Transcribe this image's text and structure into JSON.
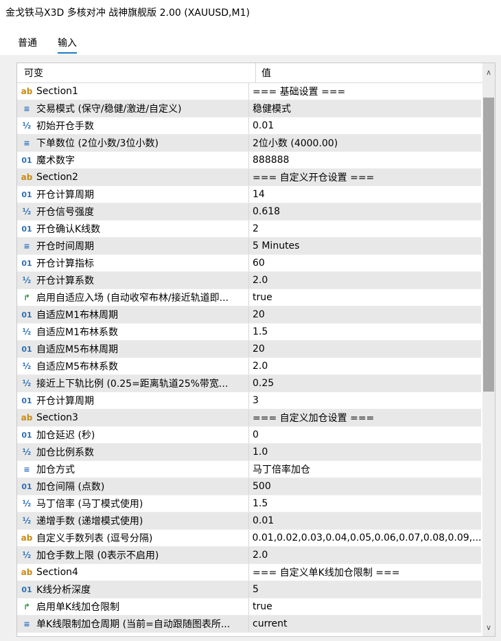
{
  "window": {
    "title": "金戈铁马X3D 多核对冲 战神旗舰版 2.00 (XAUUSD,M1)"
  },
  "tabs": [
    {
      "label": "普通",
      "active": false
    },
    {
      "label": "输入",
      "active": true
    }
  ],
  "grid": {
    "columns": [
      "可变",
      "值"
    ],
    "rows": [
      {
        "icon": "ab",
        "name": "Section1",
        "value": "=== 基础设置 ==="
      },
      {
        "icon": "enum",
        "name": "交易模式 (保守/稳健/激进/自定义)",
        "value": "稳健模式"
      },
      {
        "icon": "half",
        "name": "初始开仓手数",
        "value": "0.01"
      },
      {
        "icon": "enum",
        "name": "下单数位 (2位小数/3位小数)",
        "value": "2位小数 (4000.00)"
      },
      {
        "icon": "01",
        "name": "魔术数字",
        "value": "888888"
      },
      {
        "icon": "ab",
        "name": "Section2",
        "value": "=== 自定义开仓设置 ==="
      },
      {
        "icon": "01",
        "name": "开仓计算周期",
        "value": "14"
      },
      {
        "icon": "half",
        "name": "开仓信号强度",
        "value": "0.618"
      },
      {
        "icon": "01",
        "name": "开仓确认K线数",
        "value": "2"
      },
      {
        "icon": "enum",
        "name": "开仓时间周期",
        "value": "5 Minutes"
      },
      {
        "icon": "01",
        "name": "开仓计算指标",
        "value": "60"
      },
      {
        "icon": "half",
        "name": "开仓计算系数",
        "value": "2.0"
      },
      {
        "icon": "bool",
        "name": "启用自适应入场 (自动收窄布林/接近轨道即...",
        "value": "true"
      },
      {
        "icon": "01",
        "name": "自适应M1布林周期",
        "value": "20"
      },
      {
        "icon": "half",
        "name": "自适应M1布林系数",
        "value": "1.5"
      },
      {
        "icon": "01",
        "name": "自适应M5布林周期",
        "value": "20"
      },
      {
        "icon": "half",
        "name": "自适应M5布林系数",
        "value": "2.0"
      },
      {
        "icon": "half",
        "name": "接近上下轨比例 (0.25=距离轨道25%带宽...",
        "value": "0.25"
      },
      {
        "icon": "01",
        "name": "开仓计算周期",
        "value": "3"
      },
      {
        "icon": "ab",
        "name": "Section3",
        "value": "=== 自定义加仓设置 ==="
      },
      {
        "icon": "01",
        "name": "加仓延迟 (秒)",
        "value": "0"
      },
      {
        "icon": "half",
        "name": "加仓比例系数",
        "value": "1.0"
      },
      {
        "icon": "enum",
        "name": "加仓方式",
        "value": "马丁倍率加仓"
      },
      {
        "icon": "01",
        "name": "加仓间隔 (点数)",
        "value": "500"
      },
      {
        "icon": "half",
        "name": "马丁倍率 (马丁模式使用)",
        "value": "1.5"
      },
      {
        "icon": "half",
        "name": "递增手数 (递增模式使用)",
        "value": "0.01"
      },
      {
        "icon": "ab",
        "name": "自定义手数列表 (逗号分隔)",
        "value": "0.01,0.02,0.03,0.04,0.05,0.06,0.07,0.08,0.09,..."
      },
      {
        "icon": "half",
        "name": "加仓手数上限 (0表示不启用)",
        "value": "2.0"
      },
      {
        "icon": "ab",
        "name": "Section4",
        "value": "=== 自定义单K线加仓限制 ==="
      },
      {
        "icon": "01",
        "name": "K线分析深度",
        "value": "5"
      },
      {
        "icon": "bool",
        "name": "启用单K线加仓限制",
        "value": "true"
      },
      {
        "icon": "enum",
        "name": "单K线限制加仓周期 (当前=自动跟随图表所...",
        "value": "current"
      }
    ]
  },
  "icons": {
    "ab": {
      "glyph": "ab",
      "name": "string-type-icon"
    },
    "enum": {
      "glyph": "≡",
      "name": "enum-type-icon"
    },
    "half": {
      "glyph": "½",
      "name": "double-type-icon"
    },
    "01": {
      "glyph": "01",
      "name": "integer-type-icon"
    },
    "bool": {
      "glyph": "↱",
      "name": "bool-type-icon"
    }
  }
}
